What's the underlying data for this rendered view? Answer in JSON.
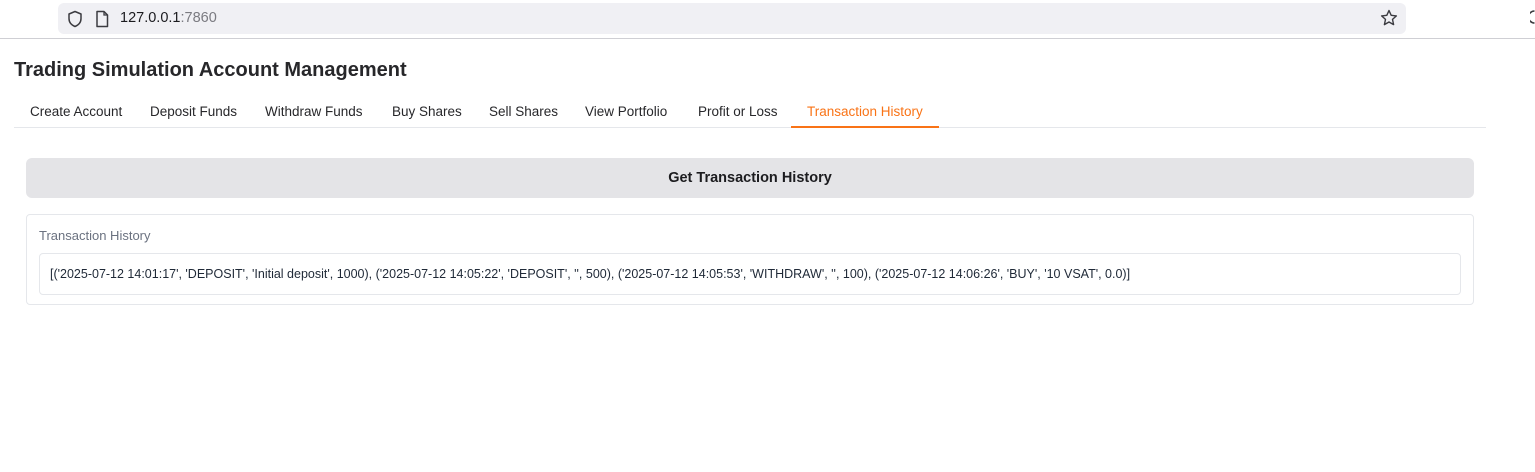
{
  "browser": {
    "url_host": "127.0.0.1",
    "url_port": ":7860"
  },
  "app": {
    "title": "Trading Simulation Account Management"
  },
  "tabs": [
    {
      "label": "Create Account",
      "active": false
    },
    {
      "label": "Deposit Funds",
      "active": false
    },
    {
      "label": "Withdraw Funds",
      "active": false
    },
    {
      "label": "Buy Shares",
      "active": false
    },
    {
      "label": "Sell Shares",
      "active": false
    },
    {
      "label": "View Portfolio",
      "active": false
    },
    {
      "label": "Profit or Loss",
      "active": false
    },
    {
      "label": "Transaction History",
      "active": true
    }
  ],
  "main": {
    "button_label": "Get Transaction History",
    "output_label": "Transaction History",
    "output_value": "[('2025-07-12 14:01:17', 'DEPOSIT', 'Initial deposit', 1000), ('2025-07-12 14:05:22', 'DEPOSIT', '', 500), ('2025-07-12 14:05:53', 'WITHDRAW', '', 100), ('2025-07-12 14:06:26', 'BUY', '10 VSAT', 0.0)]"
  },
  "colors": {
    "accent": "#f97316",
    "button_bg": "#e4e4e7"
  }
}
